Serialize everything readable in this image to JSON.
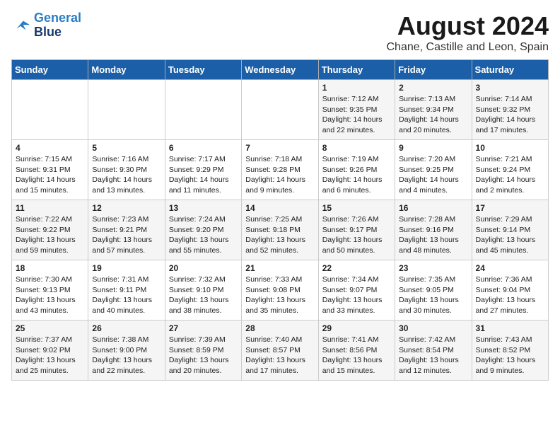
{
  "logo": {
    "line1": "General",
    "line2": "Blue"
  },
  "title": "August 2024",
  "subtitle": "Chane, Castille and Leon, Spain",
  "weekdays": [
    "Sunday",
    "Monday",
    "Tuesday",
    "Wednesday",
    "Thursday",
    "Friday",
    "Saturday"
  ],
  "weeks": [
    [
      {
        "day": "",
        "info": ""
      },
      {
        "day": "",
        "info": ""
      },
      {
        "day": "",
        "info": ""
      },
      {
        "day": "",
        "info": ""
      },
      {
        "day": "1",
        "info": "Sunrise: 7:12 AM\nSunset: 9:35 PM\nDaylight: 14 hours\nand 22 minutes."
      },
      {
        "day": "2",
        "info": "Sunrise: 7:13 AM\nSunset: 9:34 PM\nDaylight: 14 hours\nand 20 minutes."
      },
      {
        "day": "3",
        "info": "Sunrise: 7:14 AM\nSunset: 9:32 PM\nDaylight: 14 hours\nand 17 minutes."
      }
    ],
    [
      {
        "day": "4",
        "info": "Sunrise: 7:15 AM\nSunset: 9:31 PM\nDaylight: 14 hours\nand 15 minutes."
      },
      {
        "day": "5",
        "info": "Sunrise: 7:16 AM\nSunset: 9:30 PM\nDaylight: 14 hours\nand 13 minutes."
      },
      {
        "day": "6",
        "info": "Sunrise: 7:17 AM\nSunset: 9:29 PM\nDaylight: 14 hours\nand 11 minutes."
      },
      {
        "day": "7",
        "info": "Sunrise: 7:18 AM\nSunset: 9:28 PM\nDaylight: 14 hours\nand 9 minutes."
      },
      {
        "day": "8",
        "info": "Sunrise: 7:19 AM\nSunset: 9:26 PM\nDaylight: 14 hours\nand 6 minutes."
      },
      {
        "day": "9",
        "info": "Sunrise: 7:20 AM\nSunset: 9:25 PM\nDaylight: 14 hours\nand 4 minutes."
      },
      {
        "day": "10",
        "info": "Sunrise: 7:21 AM\nSunset: 9:24 PM\nDaylight: 14 hours\nand 2 minutes."
      }
    ],
    [
      {
        "day": "11",
        "info": "Sunrise: 7:22 AM\nSunset: 9:22 PM\nDaylight: 13 hours\nand 59 minutes."
      },
      {
        "day": "12",
        "info": "Sunrise: 7:23 AM\nSunset: 9:21 PM\nDaylight: 13 hours\nand 57 minutes."
      },
      {
        "day": "13",
        "info": "Sunrise: 7:24 AM\nSunset: 9:20 PM\nDaylight: 13 hours\nand 55 minutes."
      },
      {
        "day": "14",
        "info": "Sunrise: 7:25 AM\nSunset: 9:18 PM\nDaylight: 13 hours\nand 52 minutes."
      },
      {
        "day": "15",
        "info": "Sunrise: 7:26 AM\nSunset: 9:17 PM\nDaylight: 13 hours\nand 50 minutes."
      },
      {
        "day": "16",
        "info": "Sunrise: 7:28 AM\nSunset: 9:16 PM\nDaylight: 13 hours\nand 48 minutes."
      },
      {
        "day": "17",
        "info": "Sunrise: 7:29 AM\nSunset: 9:14 PM\nDaylight: 13 hours\nand 45 minutes."
      }
    ],
    [
      {
        "day": "18",
        "info": "Sunrise: 7:30 AM\nSunset: 9:13 PM\nDaylight: 13 hours\nand 43 minutes."
      },
      {
        "day": "19",
        "info": "Sunrise: 7:31 AM\nSunset: 9:11 PM\nDaylight: 13 hours\nand 40 minutes."
      },
      {
        "day": "20",
        "info": "Sunrise: 7:32 AM\nSunset: 9:10 PM\nDaylight: 13 hours\nand 38 minutes."
      },
      {
        "day": "21",
        "info": "Sunrise: 7:33 AM\nSunset: 9:08 PM\nDaylight: 13 hours\nand 35 minutes."
      },
      {
        "day": "22",
        "info": "Sunrise: 7:34 AM\nSunset: 9:07 PM\nDaylight: 13 hours\nand 33 minutes."
      },
      {
        "day": "23",
        "info": "Sunrise: 7:35 AM\nSunset: 9:05 PM\nDaylight: 13 hours\nand 30 minutes."
      },
      {
        "day": "24",
        "info": "Sunrise: 7:36 AM\nSunset: 9:04 PM\nDaylight: 13 hours\nand 27 minutes."
      }
    ],
    [
      {
        "day": "25",
        "info": "Sunrise: 7:37 AM\nSunset: 9:02 PM\nDaylight: 13 hours\nand 25 minutes."
      },
      {
        "day": "26",
        "info": "Sunrise: 7:38 AM\nSunset: 9:00 PM\nDaylight: 13 hours\nand 22 minutes."
      },
      {
        "day": "27",
        "info": "Sunrise: 7:39 AM\nSunset: 8:59 PM\nDaylight: 13 hours\nand 20 minutes."
      },
      {
        "day": "28",
        "info": "Sunrise: 7:40 AM\nSunset: 8:57 PM\nDaylight: 13 hours\nand 17 minutes."
      },
      {
        "day": "29",
        "info": "Sunrise: 7:41 AM\nSunset: 8:56 PM\nDaylight: 13 hours\nand 15 minutes."
      },
      {
        "day": "30",
        "info": "Sunrise: 7:42 AM\nSunset: 8:54 PM\nDaylight: 13 hours\nand 12 minutes."
      },
      {
        "day": "31",
        "info": "Sunrise: 7:43 AM\nSunset: 8:52 PM\nDaylight: 13 hours\nand 9 minutes."
      }
    ]
  ]
}
